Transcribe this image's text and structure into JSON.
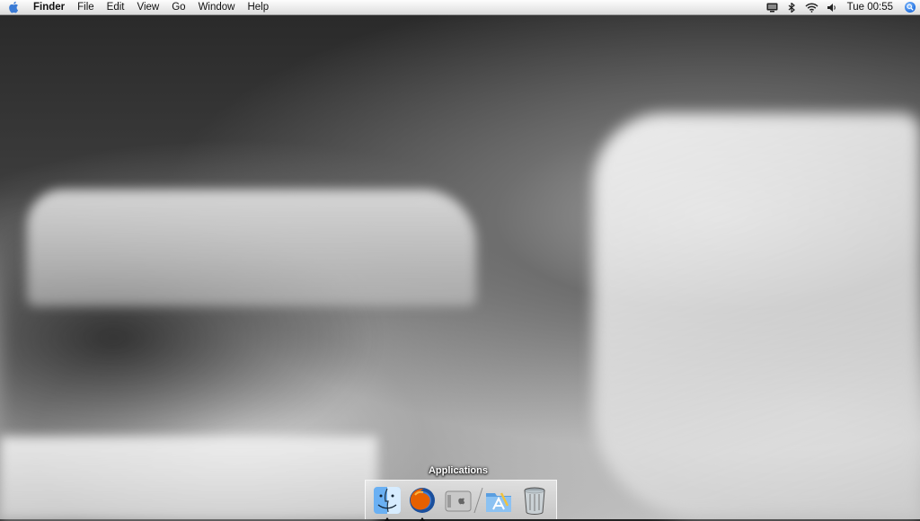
{
  "menubar": {
    "app_name": "Finder",
    "menus": [
      "File",
      "Edit",
      "View",
      "Go",
      "Window",
      "Help"
    ],
    "status_icons": [
      "display-icon",
      "bluetooth-icon",
      "wifi-icon",
      "volume-icon"
    ],
    "clock": "Tue 00:55",
    "spotlight": "spotlight-icon"
  },
  "dock": {
    "hover_label": "Applications",
    "items": [
      {
        "name": "finder-icon",
        "running": true
      },
      {
        "name": "firefox-icon",
        "running": true
      },
      {
        "name": "system-preferences-icon",
        "running": false
      },
      {
        "name": "applications-stack-icon",
        "running": false
      },
      {
        "name": "trash-icon",
        "running": false
      }
    ]
  },
  "colors": {
    "menubar_bg": "#ececec",
    "spotlight_blue": "#1e6ee0",
    "firefox_orange": "#e66000"
  }
}
